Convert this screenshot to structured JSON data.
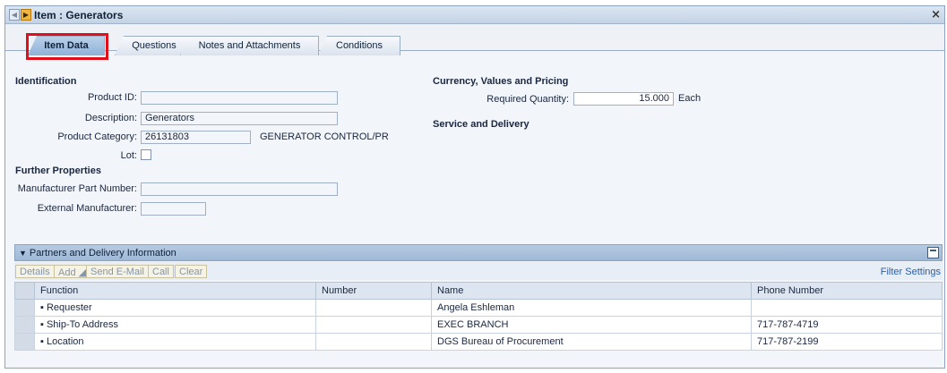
{
  "window": {
    "title": "Item : Generators",
    "prev_label": "◀",
    "next_label": "▶",
    "close_label": "×"
  },
  "tabs": [
    {
      "label": "Item Data",
      "active": true
    },
    {
      "label": "Questions",
      "active": false
    },
    {
      "label": "Notes and Attachments",
      "active": false
    },
    {
      "label": "Conditions",
      "active": false
    }
  ],
  "identification": {
    "section_title": "Identification",
    "product_id_label": "Product ID:",
    "product_id_value": "",
    "description_label": "Description:",
    "description_value": "Generators",
    "product_category_label": "Product Category:",
    "product_category_value": "26131803",
    "product_category_text": "GENERATOR CONTROL/PR",
    "lot_label": "Lot:"
  },
  "further_properties": {
    "section_title": "Further Properties",
    "mpn_label": "Manufacturer Part Number:",
    "mpn_value": "",
    "ext_mfr_label": "External Manufacturer:",
    "ext_mfr_value": ""
  },
  "pricing": {
    "section_title": "Currency, Values and Pricing",
    "req_qty_label": "Required Quantity:",
    "req_qty_value": "15.000",
    "req_qty_unit": "Each"
  },
  "service": {
    "section_title": "Service and Delivery"
  },
  "partners": {
    "title": "Partners and Delivery Information",
    "buttons": {
      "details": "Details",
      "add": "Add ◢",
      "send_email": "Send E-Mail",
      "call": "Call",
      "clear": "Clear"
    },
    "filter_settings": "Filter Settings",
    "columns": {
      "function": "Function",
      "number": "Number",
      "name": "Name",
      "phone": "Phone Number"
    },
    "rows": [
      {
        "function": "▪  Requester",
        "number": "",
        "name": "Angela Eshleman",
        "phone": ""
      },
      {
        "function": "▪  Ship-To Address",
        "number": "",
        "name": "EXEC BRANCH",
        "phone": "717-787-4719"
      },
      {
        "function": "▪  Location",
        "number": "",
        "name": "DGS Bureau of Procurement",
        "phone": "717-787-2199"
      }
    ]
  }
}
